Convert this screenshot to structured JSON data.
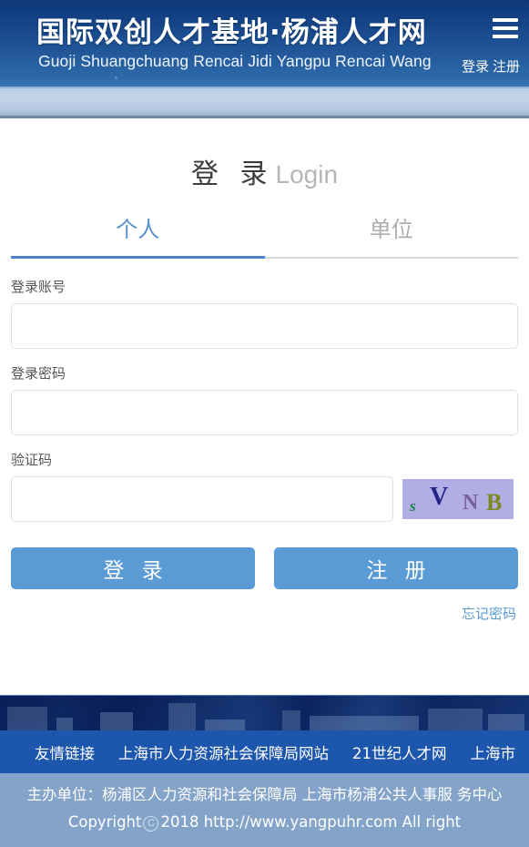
{
  "header": {
    "brand_cn": "国际双创人才基地·杨浦人才网",
    "brand_en": "Guoji Shuangchuang Rencai Jidi Yangpu Rencai Wang",
    "login_link": "登录",
    "register_link": "注册",
    "menu_icon": "hamburger-menu-icon"
  },
  "main": {
    "title_cn": "登 录",
    "title_en": "Login",
    "tabs": [
      {
        "label": "个人",
        "active": true
      },
      {
        "label": "单位",
        "active": false
      }
    ],
    "fields": {
      "account": {
        "label": "登录账号",
        "value": "",
        "placeholder": ""
      },
      "password": {
        "label": "登录密码",
        "value": "",
        "placeholder": ""
      },
      "captcha": {
        "label": "验证码",
        "value": "",
        "placeholder": ""
      }
    },
    "captcha_image": {
      "name": "captcha-image",
      "text": "sVNB",
      "chars": [
        "s",
        "V",
        "N",
        "B"
      ],
      "background": "#b0aee4",
      "char_colors": [
        "#1f7a4c",
        "#252585",
        "#7a5f9e",
        "#7d8a1e"
      ]
    },
    "buttons": {
      "login": "登 录",
      "register": "注 册"
    },
    "forgot_password": "忘记密码"
  },
  "footer": {
    "links_label": "友情链接",
    "links": [
      "上海市人力资源社会保障局网站",
      "21世纪人才网",
      "上海市"
    ],
    "copyright_line1": "主办单位：杨浦区人力资源和社会保障局 上海市杨浦公共人事服",
    "copyright_line2_pre": "务中心 Copyright",
    "copyright_mark": "C",
    "copyright_line2_post": "2018 http://www.yangpuhr.com All right"
  },
  "colors": {
    "header_top": "#0d3779",
    "header_bottom": "#3574b2",
    "accent_blue": "#5b9bd5",
    "tab_active": "#5692cf",
    "links_bar": "#1d56ad",
    "copyright_bg": "#84a3c8"
  }
}
